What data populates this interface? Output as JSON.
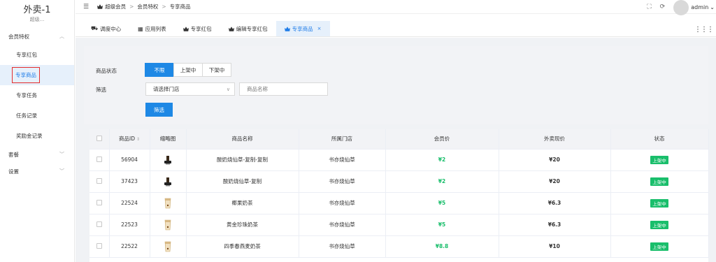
{
  "brand": {
    "title": "外卖-1",
    "subtitle": "超级..."
  },
  "sidebar": {
    "groups": [
      {
        "label": "会员特权",
        "expanded": true,
        "items": [
          "专享红包",
          "专享商品",
          "专享任务",
          "任务记录",
          "奖励金记录"
        ],
        "active": "专享商品"
      },
      {
        "label": "套餐",
        "expanded": false
      },
      {
        "label": "设置",
        "expanded": false
      }
    ]
  },
  "breadcrumb": [
    "超级会员",
    "会员特权",
    "专享商品"
  ],
  "user": {
    "name": "admin"
  },
  "tabs": [
    {
      "label": "调度中心",
      "icon": "dispatch-icon"
    },
    {
      "label": "应用列表",
      "icon": "grid-icon"
    },
    {
      "label": "专享红包",
      "icon": "crown-icon"
    },
    {
      "label": "编辑专享红包",
      "icon": "crown-icon"
    },
    {
      "label": "专享商品",
      "icon": "crown-icon",
      "active": true
    }
  ],
  "filter": {
    "status_label": "商品状态",
    "status_options": [
      "不限",
      "上架中",
      "下架中"
    ],
    "status_selected": "不限",
    "screen_label": "筛选",
    "store_placeholder": "请选择门店",
    "name_placeholder": "商品名称",
    "button": "筛选"
  },
  "table": {
    "columns": [
      "商品ID",
      "缩略图",
      "商品名称",
      "所属门店",
      "会员价",
      "外卖现价",
      "状态"
    ],
    "rows": [
      {
        "id": "56904",
        "name": "酸奶烧仙草-复制-复制",
        "store": "书亦烧仙草",
        "member_price": "¥2",
        "price": "¥20",
        "status": "上架中",
        "thumb": "dark"
      },
      {
        "id": "37423",
        "name": "酸奶烧仙草-复制",
        "store": "书亦烧仙草",
        "member_price": "¥2",
        "price": "¥20",
        "status": "上架中",
        "thumb": "dark"
      },
      {
        "id": "22524",
        "name": "椰果奶茶",
        "store": "书亦烧仙草",
        "member_price": "¥5",
        "price": "¥6.3",
        "status": "上架中",
        "thumb": "cup"
      },
      {
        "id": "22523",
        "name": "黄金珍珠奶茶",
        "store": "书亦烧仙草",
        "member_price": "¥5",
        "price": "¥6.3",
        "status": "上架中",
        "thumb": "cup"
      },
      {
        "id": "22522",
        "name": "四季春燕麦奶茶",
        "store": "书亦烧仙草",
        "member_price": "¥8.8",
        "price": "¥10",
        "status": "上架中",
        "thumb": "cup"
      }
    ]
  },
  "colors": {
    "primary": "#1e88e5",
    "green": "#19be6b",
    "highlight_border": "#e52d2d"
  }
}
